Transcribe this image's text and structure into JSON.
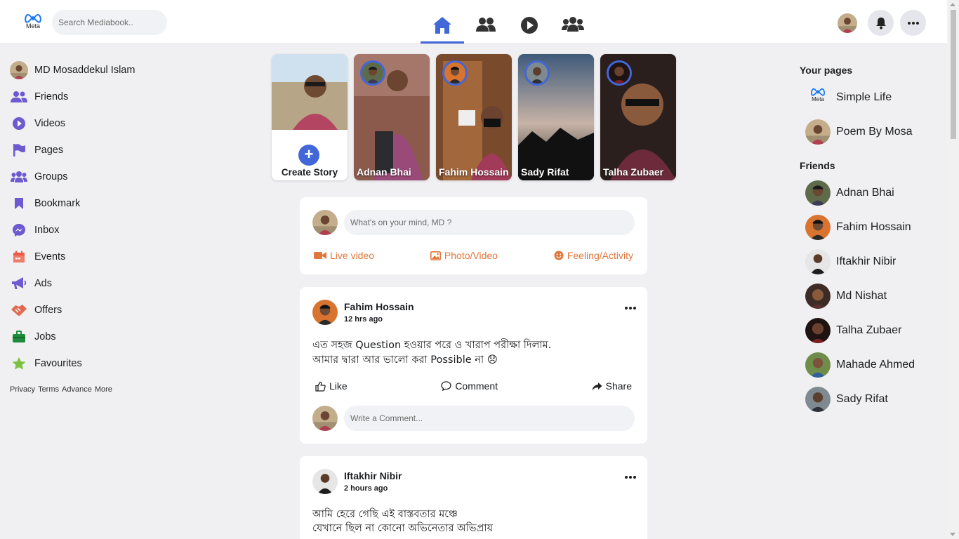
{
  "header": {
    "logo_text": "Meta",
    "search_placeholder": "Search Mediabook.."
  },
  "colors": {
    "accent": "#4267d8",
    "action": "#e0773b",
    "purple": "#6e5ad0"
  },
  "sidebar": {
    "profile_name": "MD Mosaddekul Islam",
    "items": [
      {
        "label": "Friends",
        "icon": "friends-icon"
      },
      {
        "label": "Videos",
        "icon": "play-icon"
      },
      {
        "label": "Pages",
        "icon": "flag-icon"
      },
      {
        "label": "Groups",
        "icon": "groups-icon"
      },
      {
        "label": "Bookmark",
        "icon": "bookmark-icon"
      },
      {
        "label": "Inbox",
        "icon": "messenger-icon"
      },
      {
        "label": "Events",
        "icon": "calendar-icon"
      },
      {
        "label": "Ads",
        "icon": "megaphone-icon"
      },
      {
        "label": "Offers",
        "icon": "handshake-icon"
      },
      {
        "label": "Jobs",
        "icon": "briefcase-icon"
      },
      {
        "label": "Favourites",
        "icon": "star-icon"
      }
    ],
    "footer": [
      "Privacy",
      "Terms",
      "Advance",
      "More"
    ]
  },
  "stories": {
    "create_label": "Create Story",
    "items": [
      {
        "name": "Adnan Bhai"
      },
      {
        "name": "Fahim Hossain"
      },
      {
        "name": "Sady Rifat"
      },
      {
        "name": "Talha Zubaer"
      }
    ]
  },
  "composer": {
    "placeholder": "What's on your mind, MD ?",
    "live": "Live video",
    "photo": "Photo/Video",
    "feeling": "Feeling/Activity"
  },
  "posts": [
    {
      "author": "Fahim Hossain",
      "time": "12 hrs ago",
      "line1": "এত সহজ Question হওয়ার পরে ও খারাপ পরীক্ষা দিলাম.",
      "line2": "আমার দ্বারা আর ভালো করা Possible না 😞",
      "like": "Like",
      "comment": "Comment",
      "share": "Share",
      "comment_placeholder": "Write a Comment..."
    },
    {
      "author": "Iftakhir Nibir",
      "time": "2 hours ago",
      "line1": "আমি হেরে গেছি এই বাস্তবতার মঞ্চে",
      "line2": "যেখানে ছিল না কোনো অভিনেতার অভিপ্রায়"
    }
  ],
  "right": {
    "pages_title": "Your pages",
    "pages": [
      {
        "name": "Simple Life"
      },
      {
        "name": "Poem By Mosa"
      }
    ],
    "friends_title": "Friends",
    "friends": [
      {
        "name": "Adnan Bhai"
      },
      {
        "name": "Fahim Hossain"
      },
      {
        "name": "Iftakhir Nibir"
      },
      {
        "name": "Md Nishat"
      },
      {
        "name": "Talha Zubaer"
      },
      {
        "name": "Mahade Ahmed"
      },
      {
        "name": "Sady Rifat"
      }
    ]
  }
}
